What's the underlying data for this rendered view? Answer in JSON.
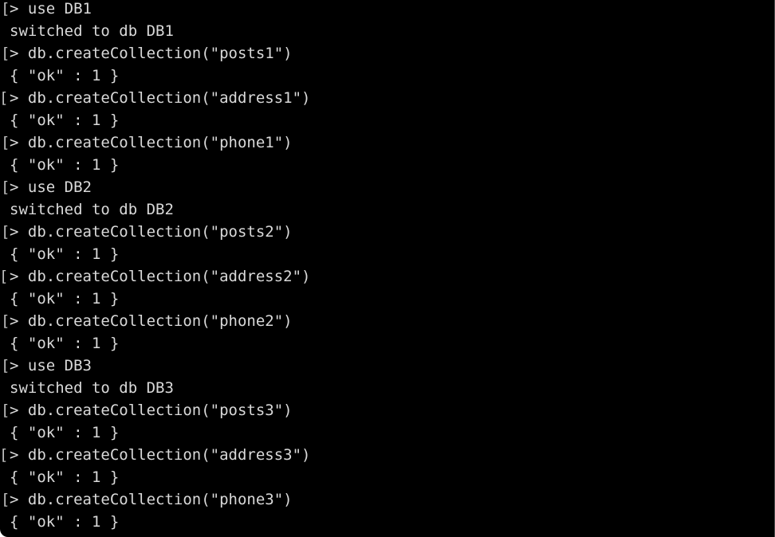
{
  "terminal": {
    "lines": [
      {
        "kind": "command",
        "text": "> use DB1",
        "marker": "["
      },
      {
        "kind": "output",
        "text": "switched to db DB1",
        "marker": ""
      },
      {
        "kind": "command",
        "text": "> db.createCollection(\"posts1\")",
        "marker": "["
      },
      {
        "kind": "output",
        "text": "{ \"ok\" : 1 }",
        "marker": ""
      },
      {
        "kind": "command",
        "text": "> db.createCollection(\"address1\")",
        "marker": "["
      },
      {
        "kind": "output",
        "text": "{ \"ok\" : 1 }",
        "marker": ""
      },
      {
        "kind": "command",
        "text": "> db.createCollection(\"phone1\")",
        "marker": "["
      },
      {
        "kind": "output",
        "text": "{ \"ok\" : 1 }",
        "marker": ""
      },
      {
        "kind": "command",
        "text": "> use DB2",
        "marker": "["
      },
      {
        "kind": "output",
        "text": "switched to db DB2",
        "marker": ""
      },
      {
        "kind": "command",
        "text": "> db.createCollection(\"posts2\")",
        "marker": "["
      },
      {
        "kind": "output",
        "text": "{ \"ok\" : 1 }",
        "marker": ""
      },
      {
        "kind": "command",
        "text": "> db.createCollection(\"address2\")",
        "marker": "["
      },
      {
        "kind": "output",
        "text": "{ \"ok\" : 1 }",
        "marker": ""
      },
      {
        "kind": "command",
        "text": "> db.createCollection(\"phone2\")",
        "marker": "["
      },
      {
        "kind": "output",
        "text": "{ \"ok\" : 1 }",
        "marker": ""
      },
      {
        "kind": "command",
        "text": "> use DB3",
        "marker": "["
      },
      {
        "kind": "output",
        "text": "switched to db DB3",
        "marker": ""
      },
      {
        "kind": "command",
        "text": "> db.createCollection(\"posts3\")",
        "marker": "["
      },
      {
        "kind": "output",
        "text": "{ \"ok\" : 1 }",
        "marker": ""
      },
      {
        "kind": "command",
        "text": "> db.createCollection(\"address3\")",
        "marker": "["
      },
      {
        "kind": "output",
        "text": "{ \"ok\" : 1 }",
        "marker": ""
      },
      {
        "kind": "command",
        "text": "> db.createCollection(\"phone3\")",
        "marker": "["
      },
      {
        "kind": "output",
        "text": "{ \"ok\" : 1 }",
        "marker": ""
      }
    ],
    "colors": {
      "background": "#000000",
      "text": "#d9d9d9",
      "marker": "#bfbfbf"
    }
  }
}
